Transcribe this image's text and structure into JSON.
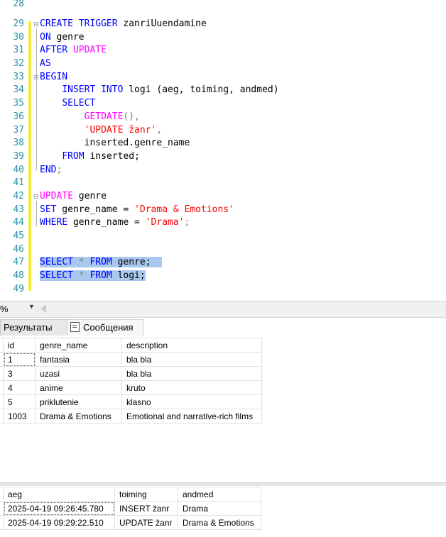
{
  "editor": {
    "line_numbers": [
      "28",
      "29",
      "30",
      "31",
      "32",
      "33",
      "34",
      "35",
      "36",
      "37",
      "38",
      "39",
      "40",
      "41",
      "42",
      "43",
      "44",
      "45",
      "46",
      "47",
      "48",
      "49"
    ]
  },
  "code": {
    "l29": {
      "kw": "CREATE TRIGGER",
      "rest": " zanriUuendamine"
    },
    "l30": {
      "kw": "ON",
      "rest": " genre"
    },
    "l31": {
      "kw": "AFTER",
      "fn": "UPDATE"
    },
    "l32": {
      "kw": "AS"
    },
    "l33": {
      "kw": "BEGIN"
    },
    "l34": {
      "kw": "INSERT INTO",
      "rest": " logi (aeg, toiming, andmed)"
    },
    "l35": {
      "kw": "SELECT"
    },
    "l36": {
      "fn": "GETDATE",
      "rest": "(),"
    },
    "l37": {
      "str": "'UPDATE žanr'",
      "rest": ","
    },
    "l38": {
      "rest": "inserted.genre_name"
    },
    "l39": {
      "kw": "FROM",
      "rest": " inserted;"
    },
    "l40": {
      "kw": "END",
      "rest": ";"
    },
    "l42": {
      "fn": "UPDATE",
      "rest": " genre"
    },
    "l43": {
      "kw": "SET",
      "rest": " genre_name = ",
      "str": "'Drama & Emotions'"
    },
    "l44": {
      "kw": "WHERE",
      "rest": " genre_name = ",
      "str": "'Drama'",
      "tail": ";"
    },
    "l47": {
      "kw1": "SELECT",
      "op": " * ",
      "kw2": "FROM",
      "rest": " genre;"
    },
    "l48": {
      "kw1": "SELECT",
      "op": " * ",
      "kw2": "FROM",
      "rest": " logi;"
    }
  },
  "statusbar": {
    "zoom": "%"
  },
  "results_tabs": {
    "results": "Результаты",
    "messages": "Сообщения"
  },
  "grid1": {
    "headers": [
      "id",
      "genre_name",
      "description"
    ],
    "rows": [
      [
        "1",
        "fantasia",
        "bla bla"
      ],
      [
        "3",
        "uzasi",
        "bla bla"
      ],
      [
        "4",
        "anime",
        "kruto"
      ],
      [
        "5",
        "priklutenie",
        "klasno"
      ],
      [
        "1003",
        "Drama & Emotions",
        "Emotional and narrative-rich films"
      ]
    ]
  },
  "grid2": {
    "headers": [
      "aeg",
      "toiming",
      "andmed"
    ],
    "rows": [
      [
        "2025-04-19 09:26:45.780",
        "INSERT žanr",
        "Drama"
      ],
      [
        "2025-04-19 09:29:22.510",
        "UPDATE žanr",
        "Drama & Emotions"
      ]
    ]
  },
  "colors": {
    "keyword": "#0000ff",
    "function": "#ff00ff",
    "string": "#ff0000",
    "line_number": "#2b91af",
    "selection": "#a8c8f0"
  }
}
